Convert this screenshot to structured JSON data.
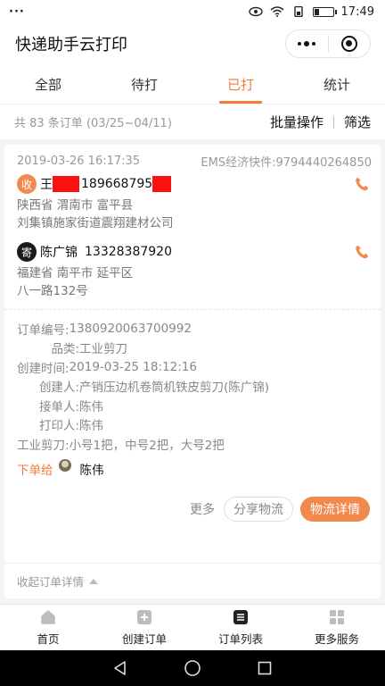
{
  "status": {
    "dots": "···",
    "time": "17:49"
  },
  "nav": {
    "title": "快递助手云打印"
  },
  "tabs": [
    {
      "label": "全部"
    },
    {
      "label": "待打"
    },
    {
      "label": "已打"
    },
    {
      "label": "统计"
    }
  ],
  "summary": {
    "count_text": "共 83 条订单 (03/25~04/11)",
    "batch_label": "批量操作",
    "filter_label": "筛选"
  },
  "order": {
    "datetime": "2019-03-26 16:17:35",
    "carrier": "EMS经济快件:9794440264850",
    "receiver": {
      "badge": "收",
      "name": "王",
      "phone": "189668795",
      "province_city": "陕西省 渭南市 富平县",
      "street": "刘集镇施家街道震翔建材公司"
    },
    "sender": {
      "badge": "寄",
      "name": "陈广锦",
      "phone": "13328387920",
      "province_city": "福建省 南平市 延平区",
      "street": "八一路132号"
    },
    "details": {
      "order_no_label": "订单编号:",
      "order_no": "1380920063700992",
      "category_label": "品类:",
      "category": "工业剪刀",
      "created_label": "创建时间:",
      "created": "2019-03-25 18:12:16",
      "creator_label": "创建人:",
      "creator": "产销压边机卷筒机铁皮剪刀(陈广锦)",
      "receiver_label": "接单人:",
      "receiver": "陈伟",
      "printer_label": "打印人:",
      "printer": "陈伟",
      "note": "工业剪刀:小号1把，中号2把，大号2把"
    },
    "assign": {
      "label": "下单给",
      "name": "陈伟"
    },
    "buttons": {
      "more": "更多",
      "share": "分享物流",
      "detail": "物流详情"
    },
    "collapse_label": "收起订单详情"
  },
  "tabbar": [
    {
      "label": "首页"
    },
    {
      "label": "创建订单"
    },
    {
      "label": "订单列表"
    },
    {
      "label": "更多服务"
    }
  ],
  "colors": {
    "accent": "#f07c3a",
    "accent_fill": "#f38a4d",
    "redact": "#ff1010"
  }
}
